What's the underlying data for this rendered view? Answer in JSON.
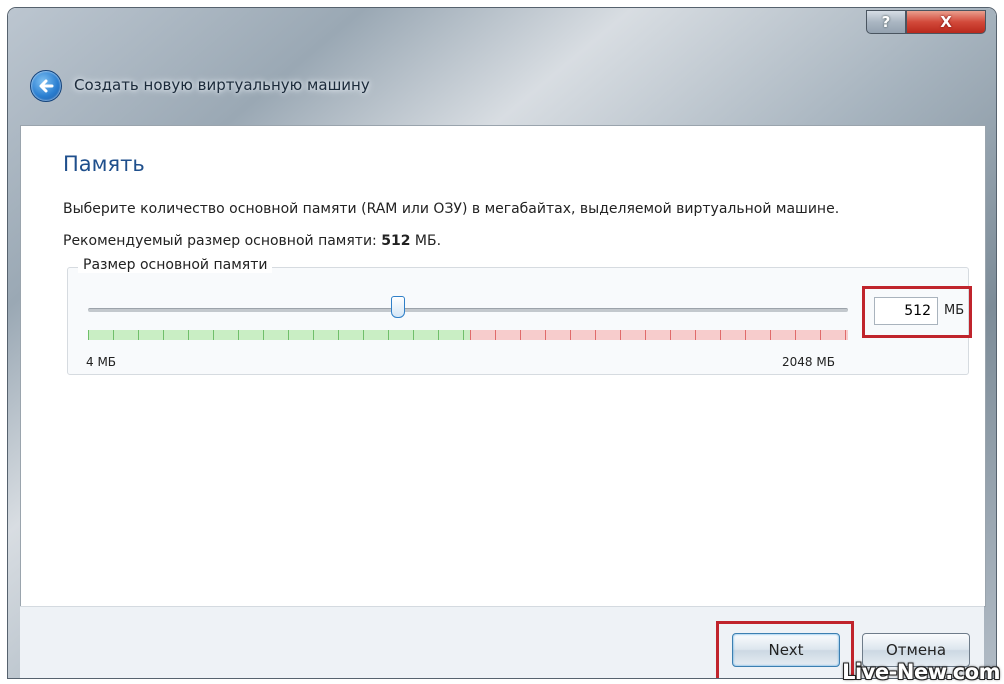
{
  "window": {
    "title": "Создать новую виртуальную машину",
    "help_label": "?",
    "close_label": "X",
    "back_icon": "arrow-left-icon"
  },
  "page": {
    "heading": "Память",
    "description": "Выберите количество основной памяти (RAM или ОЗУ) в мегабайтах, выделяемой виртуальной машине.",
    "recommended_prefix": "Рекомендуемый размер основной памяти:",
    "recommended_value": "512",
    "recommended_unit": "МБ."
  },
  "memory_group": {
    "title": "Размер основной памяти",
    "min_label": "4 МБ",
    "max_label": "2048 МБ",
    "value": "512",
    "unit": "МБ",
    "slider_min": 4,
    "slider_max": 2048,
    "slider_value": 512,
    "safe_color": "#6fbf6a",
    "warn_color": "#e06b6b"
  },
  "footer": {
    "next_label": "Next",
    "cancel_label": "Отмена"
  },
  "watermark": "Live-New.com",
  "colors": {
    "highlight": "#c0242c",
    "heading": "#1f4f8c"
  }
}
